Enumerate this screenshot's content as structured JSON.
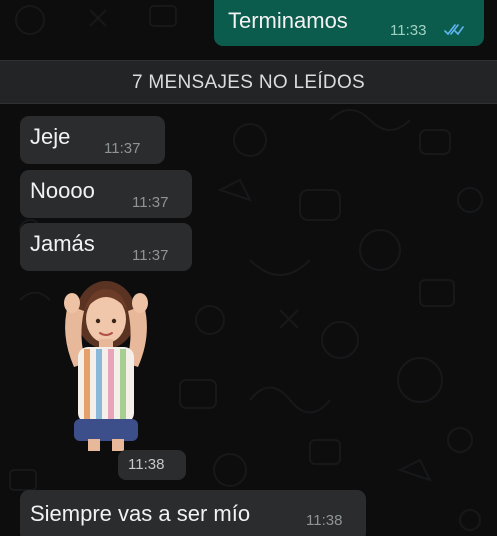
{
  "messages": {
    "outgoing": {
      "text": "Terminamos",
      "time": "11:33",
      "status_icon": "double-check-icon"
    },
    "unread_banner": "7 MENSAJES NO LEÍDOS",
    "incoming": [
      {
        "text": "Jeje",
        "time": "11:37"
      },
      {
        "text": "Noooo",
        "time": "11:37"
      },
      {
        "text": "Jamás",
        "time": "11:37"
      }
    ],
    "sticker": {
      "icon": "girl-sticker-icon",
      "time": "11:38"
    },
    "last": {
      "text": "Siempre vas a ser mío",
      "time": "11:38"
    }
  },
  "colors": {
    "background": "#0d0d0e",
    "outgoing_bubble": "#0b5c4c",
    "incoming_bubble": "#2a2c2e",
    "read_ticks": "#5fb5f0"
  }
}
